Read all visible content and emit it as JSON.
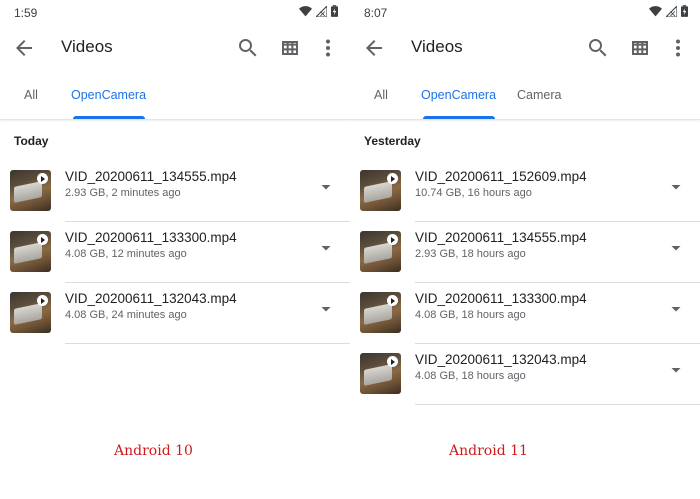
{
  "colors": {
    "accent": "#1a73e8",
    "caption": "#d1181b",
    "text": "#202124",
    "secondary": "#5f6368"
  },
  "left": {
    "status": {
      "time": "1:59"
    },
    "appbar": {
      "title": "Videos"
    },
    "tabs": [
      {
        "label": "All"
      },
      {
        "label": "OpenCamera",
        "active": true
      }
    ],
    "section": "Today",
    "files": [
      {
        "name": "VID_20200611_134555.mp4",
        "meta": "2.93 GB, 2 minutes ago"
      },
      {
        "name": "VID_20200611_133300.mp4",
        "meta": "4.08 GB, 12 minutes ago"
      },
      {
        "name": "VID_20200611_132043.mp4",
        "meta": "4.08 GB, 24 minutes ago"
      }
    ],
    "caption": "Android 10"
  },
  "right": {
    "status": {
      "time": "8:07"
    },
    "appbar": {
      "title": "Videos"
    },
    "tabs": [
      {
        "label": "All"
      },
      {
        "label": "OpenCamera",
        "active": true
      },
      {
        "label": "Camera"
      }
    ],
    "section": "Yesterday",
    "files": [
      {
        "name": "VID_20200611_152609.mp4",
        "meta": "10.74 GB, 16 hours ago"
      },
      {
        "name": "VID_20200611_134555.mp4",
        "meta": "2.93 GB, 18 hours ago"
      },
      {
        "name": "VID_20200611_133300.mp4",
        "meta": "4.08 GB, 18 hours ago"
      },
      {
        "name": "VID_20200611_132043.mp4",
        "meta": "4.08 GB, 18 hours ago"
      }
    ],
    "caption": "Android 11"
  }
}
